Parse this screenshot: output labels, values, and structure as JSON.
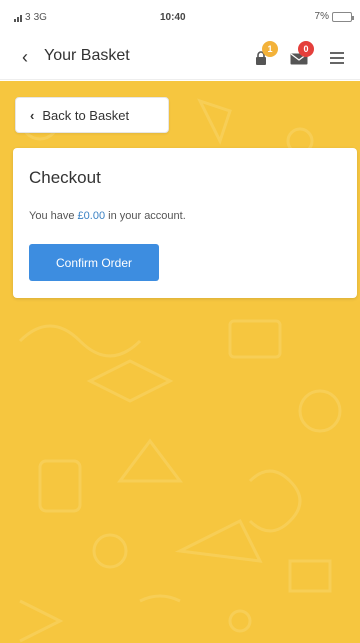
{
  "status_bar": {
    "carrier": "3",
    "network": "3G",
    "time": "10:40",
    "battery": "7%"
  },
  "header": {
    "title": "Your Basket",
    "lock_badge": "1",
    "mail_badge": "0"
  },
  "back_button": {
    "label": "Back to Basket"
  },
  "checkout": {
    "title": "Checkout",
    "text_before": "You have ",
    "amount": "£0.00",
    "text_after": " in your account.",
    "confirm_label": "Confirm Order"
  },
  "colors": {
    "background": "#f6c63f",
    "primary_button": "#3d8de0",
    "amount_text": "#3b82c4",
    "badge_yellow": "#f3b23a",
    "badge_red": "#e43f3b"
  },
  "icons": {
    "back": "chevron-left-icon",
    "lock": "lock-icon",
    "mail": "mail-icon",
    "menu": "hamburger-menu-icon"
  }
}
